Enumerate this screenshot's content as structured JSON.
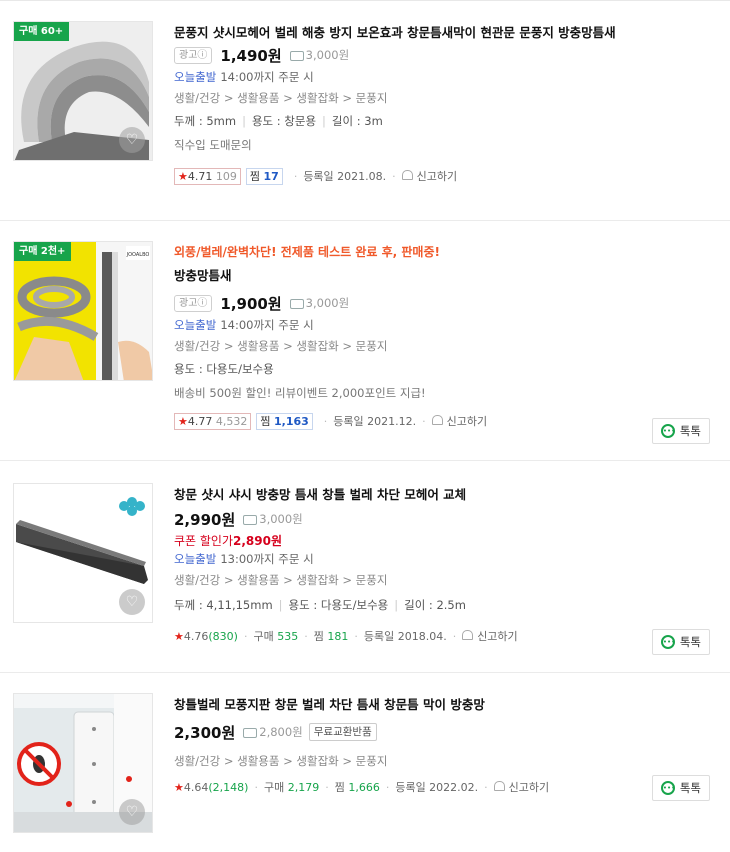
{
  "products": [
    {
      "badge": "구매 60+",
      "promo": "",
      "title": "문풍지 샷시모헤어 벌레 해충 방지 보온효과 창문틈새막이 현관문 문풍지 방충망틈새",
      "ad_label": "광고ⓘ",
      "price": "1,490원",
      "shipping": "3,000원",
      "today_label": "오늘출발",
      "today_text": "14:00까지 주문 시",
      "category": "생활/건강 > 생활용품 > 생활잡화 > 문풍지",
      "attrs": [
        "두께 : 5mm",
        "용도 : 창문용",
        "길이 : 3m"
      ],
      "desc": "직수입 도매문의",
      "rating": "4.71",
      "review_count": "109",
      "zzim_label": "찜",
      "zzim_count": "17",
      "registered": "등록일 2021.08.",
      "report": "신고하기"
    },
    {
      "badge": "구매 2천+",
      "promo": "외풍/벌레/완벽차단! 전제품 테스트 완료 후, 판매중!",
      "title": "방충망틈새",
      "ad_label": "광고ⓘ",
      "price": "1,900원",
      "shipping": "3,000원",
      "today_label": "오늘출발",
      "today_text": "14:00까지 주문 시",
      "category": "생활/건강 > 생활용품 > 생활잡화 > 문풍지",
      "attrs": [
        "용도 : 다용도/보수용"
      ],
      "desc": "배송비 500원 할인! 리뷰이벤트 2,000포인트 지급!",
      "rating": "4.77",
      "review_count": "4,532",
      "zzim_label": "찜",
      "zzim_count": "1,163",
      "registered": "등록일 2021.12.",
      "report": "신고하기",
      "talk": "톡톡",
      "brand_mark": "JOOALBO"
    },
    {
      "badge": "",
      "title": "창문 샷시 샤시 방충망 틈새 창틀 벌레 차단 모헤어 교체",
      "price": "2,990원",
      "shipping": "3,000원",
      "coupon_label": "쿠폰 할인가",
      "coupon_price": "2,890원",
      "today_label": "오늘출발",
      "today_text": "13:00까지 주문 시",
      "category": "생활/건강 > 생활용품 > 생활잡화 > 문풍지",
      "attrs": [
        "두께 : 4,11,15mm",
        "용도 : 다용도/보수용",
        "길이 : 2.5m"
      ],
      "rating": "4.76",
      "review_count": "(830)",
      "purchase_label": "구매",
      "purchase_count": "535",
      "zzim_label": "찜",
      "zzim_count": "181",
      "registered": "등록일 2018.04.",
      "report": "신고하기",
      "talk": "톡톡"
    },
    {
      "badge": "",
      "title": "창틀벌레 모풍지판 창문 벌레 차단 틈새 창문틈 막이 방충망",
      "price": "2,300원",
      "shipping": "2,800원",
      "exchange": "무료교환반품",
      "category": "생활/건강 > 생활용품 > 생활잡화 > 문풍지",
      "rating": "4.64",
      "review_count": "(2,148)",
      "purchase_label": "구매",
      "purchase_count": "2,179",
      "zzim_label": "찜",
      "zzim_count": "1,666",
      "registered": "등록일 2022.02.",
      "report": "신고하기",
      "talk": "톡톡"
    }
  ]
}
